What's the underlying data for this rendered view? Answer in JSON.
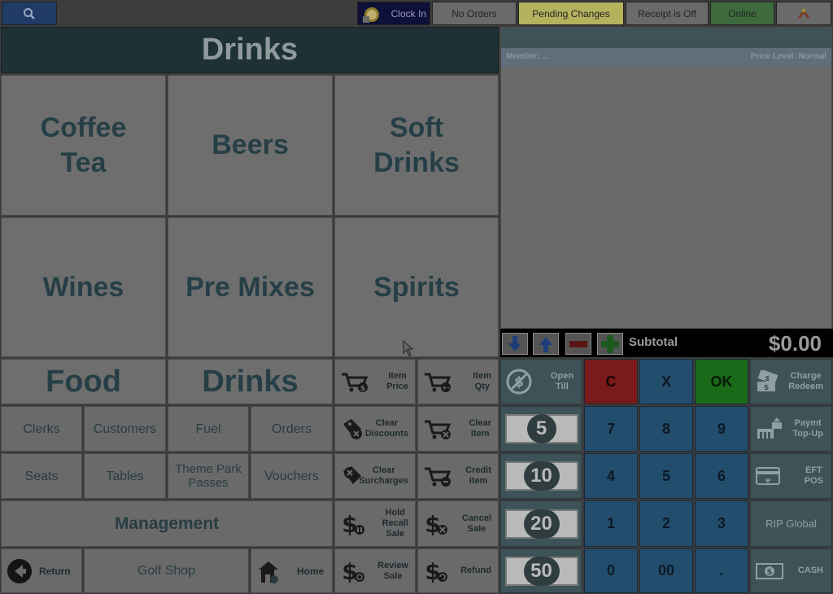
{
  "topbar": {
    "clock_in": "Clock In",
    "no_orders": "No Orders",
    "pending": "Pending Changes",
    "receipt": "Receipt is Off",
    "online": "Online"
  },
  "header": {
    "title": "Drinks"
  },
  "categories": [
    "Coffee\nTea",
    "Beers",
    "Soft\nDrinks",
    "Wines",
    "Pre Mixes",
    "Spirits"
  ],
  "tabs": {
    "food": "Food",
    "drinks": "Drinks"
  },
  "small_buttons": {
    "clerks": "Clerks",
    "customers": "Customers",
    "fuel": "Fuel",
    "orders": "Orders",
    "seats": "Seats",
    "tables": "Tables",
    "theme_park": "Theme Park\nPasses",
    "vouchers": "Vouchers",
    "management": "Management",
    "golf_shop": "Golf Shop"
  },
  "nav": {
    "return": "Return",
    "home": "Home"
  },
  "actions": {
    "item_price": "Item\nPrice",
    "item_qty": "Item\nQty",
    "clear_discounts": "Clear\nDiscounts",
    "clear_item": "Clear\nItem",
    "clear_surcharges": "Clear\nSurcharges",
    "credit_item": "Credit\nItem",
    "hold_recall": "Hold\nRecall\nSale",
    "cancel_sale": "Cancel\nSale",
    "review_sale": "Review\nSale",
    "refund": "Refund"
  },
  "order": {
    "member": "Member: ...",
    "price_level": "Price Level: Normal",
    "subtotal_label": "Subtotal",
    "subtotal_value": "$0.00"
  },
  "keypad": {
    "c": "C",
    "x": "X",
    "ok": "OK",
    "k7": "7",
    "k8": "8",
    "k9": "9",
    "k4": "4",
    "k5": "5",
    "k6": "6",
    "k1": "1",
    "k2": "2",
    "k3": "3",
    "k0": "0",
    "k00": "00",
    "dot": "."
  },
  "notes": [
    "5",
    "10",
    "20",
    "50"
  ],
  "right_buttons": {
    "open_till": "Open\nTill",
    "charge_redeem": "Charge\nRedeem",
    "paymt_topup": "Paymt\nTop-Up",
    "eft_pos": "EFT\nPOS",
    "rip_global": "RIP Global",
    "cash": "CASH"
  },
  "colors": {
    "pending": "#b5b25e",
    "online": "#3e6b3e",
    "c_key": "#7a1a1a",
    "ok_key": "#1a6a1a",
    "key": "#234d6c"
  }
}
